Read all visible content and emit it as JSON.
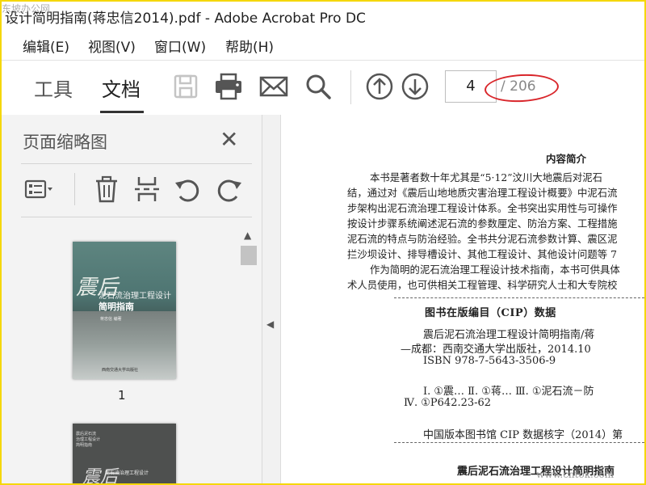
{
  "window": {
    "title": "设计简明指南(蒋忠信2014).pdf - Adobe Acrobat Pro DC",
    "watermark_top": "东坡办公网",
    "watermark_bottom": "www.cntok.com"
  },
  "menu": [
    "编辑(E)",
    "视图(V)",
    "窗口(W)",
    "帮助(H)"
  ],
  "tabs": {
    "tools": "工具",
    "document": "文档"
  },
  "toolbar_icons": [
    "save-icon",
    "print-icon",
    "email-icon",
    "search-icon",
    "previous-page-icon",
    "next-page-icon"
  ],
  "page_nav": {
    "current": "4",
    "total": "/ 206"
  },
  "thumbnails_panel": {
    "title": "页面缩略图",
    "close": "✕",
    "tool_icons": [
      "page-options-icon",
      "delete-icon",
      "extract-icon",
      "rotate-left-icon",
      "rotate-right-icon"
    ],
    "items": [
      {
        "label": "1",
        "cover_char": "震后",
        "cover_title_line1": "泥石流治理工程设计",
        "cover_title_line2": "简明指南",
        "cover_author": "蒋忠信 编著",
        "cover_publisher": "西南交通大学出版社"
      },
      {
        "cover_lines": [
          "震后泥石流",
          "治理工程设计",
          "简明指南"
        ],
        "cover_char": "震后",
        "cover_title": "泥石流治理工程设计"
      }
    ]
  },
  "document": {
    "intro_heading": "内容简介",
    "intro_lines": [
      "本书是著者数十年尤其是“5·12”汶川大地震后对泥石",
      "结，通过对《震后山地地质灾害治理工程设计概要》中泥石流",
      "步架构出泥石流治理工程设计体系。全书突出实用性与可操作",
      "按设计步骤系统阐述泥石流的参数厘定、防治方案、工程措施",
      "泥石流的特点与防治经验。全书共分泥石流参数计算、震区泥",
      "拦沙坝设计、排导槽设计、其他工程设计、其他设计问题等 7",
      "作为简明的泥石流治理工程设计技术指南，本书可供具体",
      "术人员使用，也可供相关工程管理、科学研究人士和大专院校"
    ],
    "cip_heading": "图书在版编目（CIP）数据",
    "cip_lines": [
      "震后泥石流治理工程设计简明指南/蒋",
      "—成都：西南交通大学出版社，2014.10",
      "ISBN 978-7-5643-3506-9",
      "Ⅰ. ①震… Ⅱ. ①蒋… Ⅲ. ①泥石流－防",
      "Ⅳ. ①P642.23-62",
      "中国版本图书馆 CIP 数据核字（2014）第"
    ],
    "next_title": "震后泥石流治理工程设计简明指南"
  }
}
